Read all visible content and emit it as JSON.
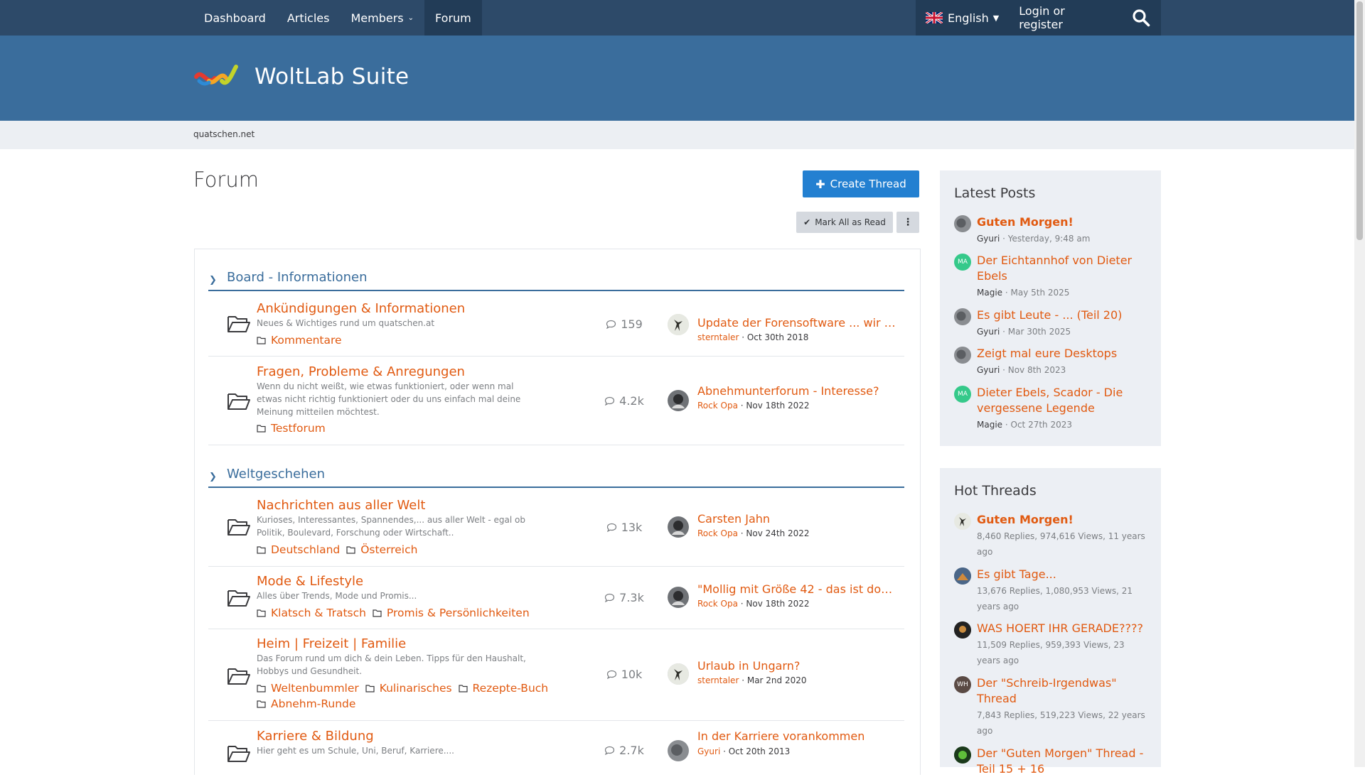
{
  "nav": {
    "items": [
      "Dashboard",
      "Articles",
      "Members",
      "Forum"
    ],
    "language": "English",
    "login": "Login or register"
  },
  "brand": {
    "name": "WoltLab Suite"
  },
  "breadcrumb": "quatschen.net",
  "page": {
    "title": "Forum",
    "create_label": "Create Thread",
    "mark_label": "Mark All as Read"
  },
  "sections": [
    {
      "title": "Board - Informationen",
      "boards": [
        {
          "name": "Ankündigungen & Informationen",
          "desc": "Neues & Wichtiges rund um quatschen.at",
          "subs": [
            "Kommentare"
          ],
          "count": "159",
          "last_title": "Update der Forensoftware ... wir s...",
          "last_user": "sterntaler",
          "last_date": "Oct 30th 2018"
        },
        {
          "name": "Fragen, Probleme & Anregungen",
          "desc": "Wenn du nicht weißt, wie etwas funktioniert, oder wenn mal etwas nicht richtig funktioniert oder du uns einfach mal deine Meinung mitteilen möchtest.",
          "subs": [
            "Testforum"
          ],
          "count": "4.2k",
          "last_title": "Abnehmunterforum - Interesse?",
          "last_user": "Rock Opa",
          "last_date": "Nov 18th 2022"
        }
      ]
    },
    {
      "title": "Weltgeschehen",
      "boards": [
        {
          "name": "Nachrichten aus aller Welt",
          "desc": "Kurioses, Interessantes, Spannendes,... aus aller Welt - egal ob Politik, Boulevard, Forschung oder Wirtschaft..",
          "subs": [
            "Deutschland",
            "Österreich"
          ],
          "count": "13k",
          "last_title": "Carsten Jahn",
          "last_user": "Rock Opa",
          "last_date": "Nov 24th 2022"
        },
        {
          "name": "Mode & Lifestyle",
          "desc": "Alles über Trends, Mode und Promis...",
          "subs": [
            "Klatsch & Tratsch",
            "Promis & Persönlichkeiten"
          ],
          "count": "7.3k",
          "last_title": "\"Mollig mit Größe 42 - das ist doc...",
          "last_user": "Rock Opa",
          "last_date": "Nov 18th 2022"
        },
        {
          "name": "Heim | Freizeit | Familie",
          "desc": "Das Forum rund um dich & dein Leben. Tipps für den Haushalt, Hobbys und Gesundheit.",
          "subs": [
            "Weltenbummler",
            "Kulinarisches",
            "Rezepte-Buch",
            "Abnehm-Runde"
          ],
          "count": "10k",
          "last_title": "Urlaub in Ungarn?",
          "last_user": "sterntaler",
          "last_date": "Mar 2nd 2020"
        },
        {
          "name": "Karriere & Bildung",
          "desc": "Hier geht es um Schule, Uni, Beruf, Karriere....",
          "subs": [],
          "count": "2.7k",
          "last_title": "In der Karriere vorankommen",
          "last_user": "Gyuri",
          "last_date": "Oct 20th 2013"
        }
      ]
    }
  ],
  "latest_posts": {
    "title": "Latest Posts",
    "items": [
      {
        "title": "Guten Morgen!",
        "user": "Gyuri",
        "date": "Yesterday, 9:48 am",
        "avatar": ""
      },
      {
        "title": "Der Eichtannhof von Dieter Ebels",
        "user": "Magie",
        "date": "May 5th 2025",
        "avatar": "MA"
      },
      {
        "title": "Es gibt Leute - ... (Teil 20)",
        "user": "Gyuri",
        "date": "Mar 30th 2025",
        "avatar": ""
      },
      {
        "title": "Zeigt mal eure Desktops",
        "user": "Gyuri",
        "date": "Nov 8th 2023",
        "avatar": ""
      },
      {
        "title": "Dieter Ebels, Scador - Die vergessene Legende",
        "user": "Magie",
        "date": "Oct 27th 2023",
        "avatar": "MA"
      }
    ]
  },
  "hot_threads": {
    "title": "Hot Threads",
    "items": [
      {
        "title": "Guten Morgen!",
        "meta": "8,460 Replies, 974,616 Views, 11 years ago",
        "avatar": ""
      },
      {
        "title": "Es gibt Tage...",
        "meta": "13,676 Replies, 1,080,953 Views, 21 years ago",
        "avatar": ""
      },
      {
        "title": "WAS HOERT IHR GERADE????",
        "meta": "11,509 Replies, 959,393 Views, 23 years ago",
        "avatar": ""
      },
      {
        "title": "Der \"Schreib-Irgendwas\" Thread",
        "meta": "7,843 Replies, 519,223 Views, 22 years ago",
        "avatar": "WH"
      },
      {
        "title": "Der \"Guten Morgen\" Thread - Teil 15 + 16",
        "meta": "",
        "avatar": ""
      }
    ]
  },
  "colors": {
    "nav": "#2d4a69",
    "header": "#3a6d9c",
    "link": "#e15a11",
    "button": "#2380d1"
  }
}
